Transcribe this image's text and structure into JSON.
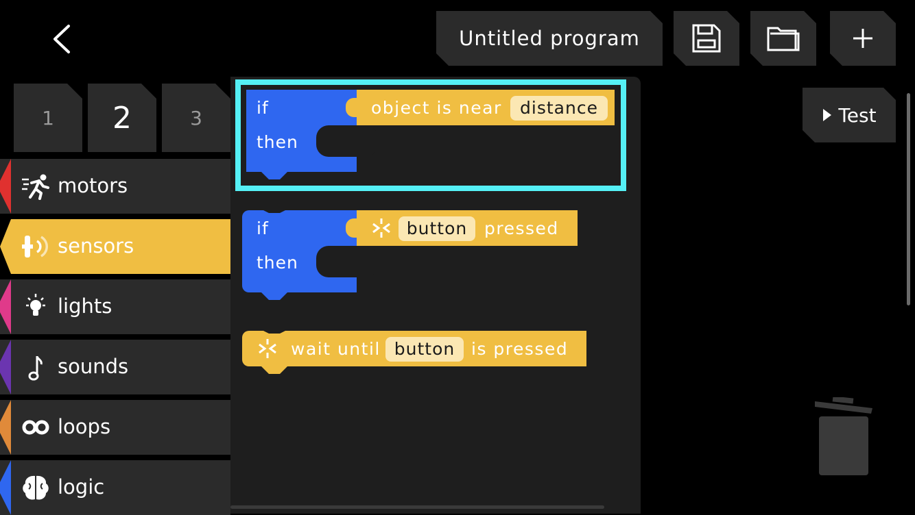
{
  "header": {
    "back_icon": "chevron-left-icon",
    "program_title": "Untitled program",
    "save_icon": "floppy-disk-icon",
    "open_icon": "folder-icon",
    "add_icon": "plus-icon"
  },
  "test_button": {
    "label": "Test",
    "icon": "play-icon"
  },
  "page_tabs": [
    {
      "label": "1",
      "active": false
    },
    {
      "label": "2",
      "active": true
    },
    {
      "label": "3",
      "active": false
    }
  ],
  "categories": [
    {
      "label": "motors",
      "icon": "running-person-icon",
      "color": "#e0312f"
    },
    {
      "label": "sensors",
      "icon": "sensor-icon",
      "color": "#f0be42",
      "active": true
    },
    {
      "label": "lights",
      "icon": "lightbulb-icon",
      "color": "#e03a8a"
    },
    {
      "label": "sounds",
      "icon": "music-note-icon",
      "color": "#6b35b0"
    },
    {
      "label": "loops",
      "icon": "infinity-icon",
      "color": "#e08a3a"
    },
    {
      "label": "logic",
      "icon": "brain-icon",
      "color": "#2f67f0"
    }
  ],
  "blocks": {
    "block1": {
      "if": "if",
      "then": "then",
      "condition": "object is near",
      "param": "distance"
    },
    "block2": {
      "if": "if",
      "then": "then",
      "param": "button",
      "suffix": "pressed"
    },
    "block3": {
      "prefix": "wait until",
      "param": "button",
      "suffix": "is pressed"
    }
  },
  "colors": {
    "logic_blue": "#2f67f0",
    "sensor_yellow": "#f0be42",
    "highlight": "#55f0f5"
  },
  "trash_icon": "trash-can-icon"
}
